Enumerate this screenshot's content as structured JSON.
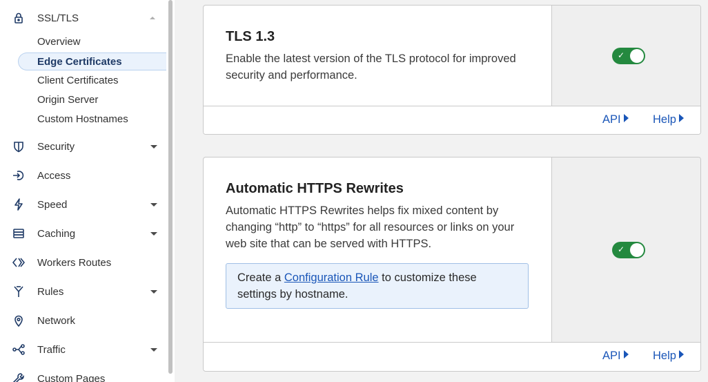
{
  "sidebar": {
    "ssl_tls": "SSL/TLS",
    "sub_items": [
      "Overview",
      "Edge Certificates",
      "Client Certificates",
      "Origin Server",
      "Custom Hostnames"
    ],
    "active_sub_item": "Edge Certificates",
    "items": [
      {
        "label": "Security",
        "icon": "shield-icon",
        "expandable": true
      },
      {
        "label": "Access",
        "icon": "access-icon",
        "expandable": false
      },
      {
        "label": "Speed",
        "icon": "lightning-icon",
        "expandable": true
      },
      {
        "label": "Caching",
        "icon": "caching-icon",
        "expandable": true
      },
      {
        "label": "Workers Routes",
        "icon": "workers-icon",
        "expandable": false
      },
      {
        "label": "Rules",
        "icon": "rules-icon",
        "expandable": true
      },
      {
        "label": "Network",
        "icon": "location-pin-icon",
        "expandable": false
      },
      {
        "label": "Traffic",
        "icon": "traffic-icon",
        "expandable": true
      },
      {
        "label": "Custom Pages",
        "icon": "wrench-icon",
        "expandable": false
      }
    ]
  },
  "cards": {
    "tls13": {
      "title": "TLS 1.3",
      "description": "Enable the latest version of the TLS protocol for improved security and performance.",
      "enabled": true,
      "api_label": "API",
      "help_label": "Help"
    },
    "https_rewrites": {
      "title": "Automatic HTTPS Rewrites",
      "description": "Automatic HTTPS Rewrites helps fix mixed content by changing “http” to “https” for all resources or links on your web site that can be served with HTTPS.",
      "info_prefix": "Create a ",
      "info_link": "Configuration Rule",
      "info_suffix": " to customize these settings by hostname.",
      "enabled": true,
      "api_label": "API",
      "help_label": "Help"
    }
  },
  "colors": {
    "toggle_on": "#24893f",
    "link": "#1a56b8",
    "active_bg": "#eaf2fc"
  }
}
